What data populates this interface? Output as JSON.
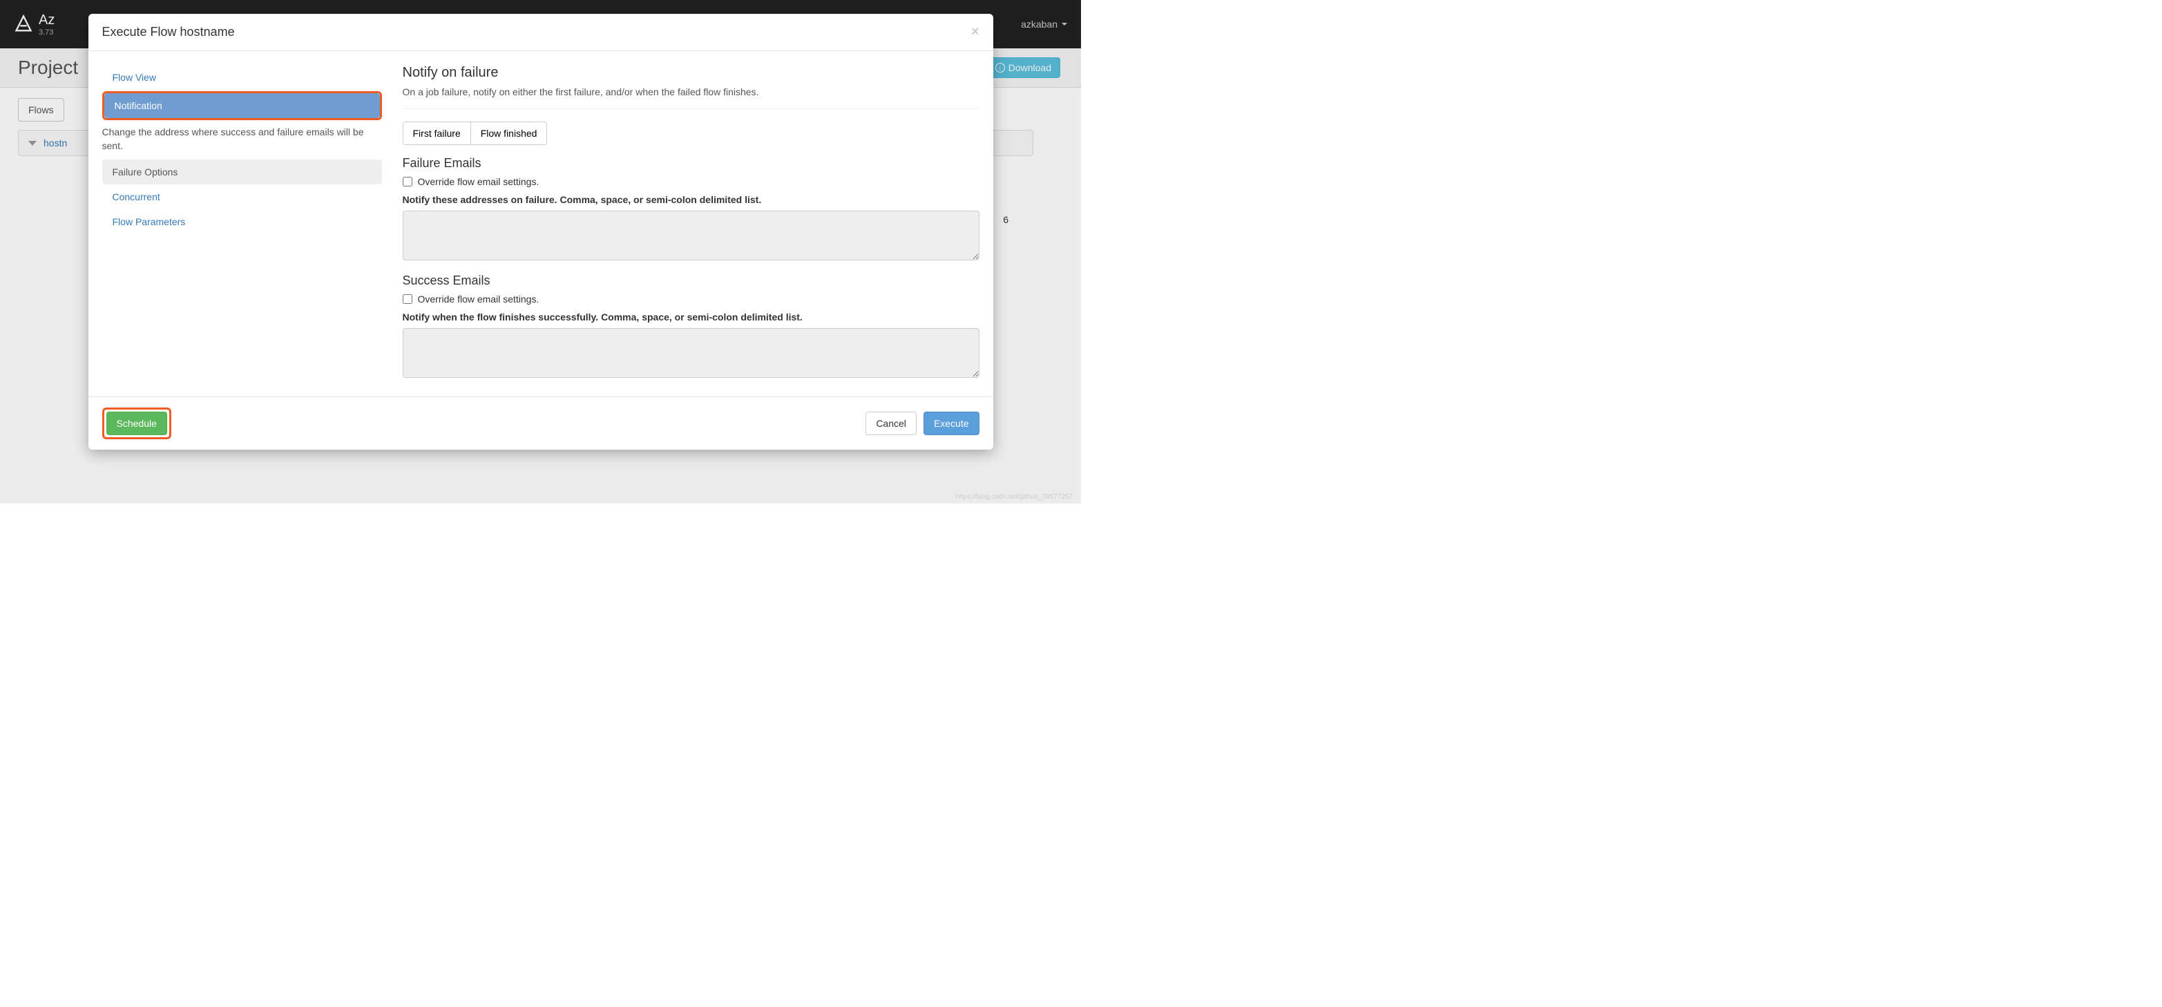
{
  "navbar": {
    "brand": "Az",
    "version": "3.73",
    "user": "azkaban"
  },
  "page": {
    "title": "Project",
    "download_btn": "Download",
    "tab_flows": "Flows",
    "flow_name": "hostn",
    "page_num_fragment": "6"
  },
  "modal": {
    "title": "Execute Flow hostname",
    "close": "×",
    "nav": {
      "flow_view": "Flow View",
      "notification": "Notification",
      "notification_desc": "Change the address where success and failure emails will be sent.",
      "failure_options": "Failure Options",
      "concurrent": "Concurrent",
      "flow_parameters": "Flow Parameters"
    },
    "panel": {
      "notify_title": "Notify on failure",
      "notify_desc": "On a job failure, notify on either the first failure, and/or when the failed flow finishes.",
      "btn_first_failure": "First failure",
      "btn_flow_finished": "Flow finished",
      "failure_emails_title": "Failure Emails",
      "override_label": "Override flow email settings.",
      "failure_field_label": "Notify these addresses on failure. Comma, space, or semi-colon delimited list.",
      "success_emails_title": "Success Emails",
      "success_field_label": "Notify when the flow finishes successfully. Comma, space, or semi-colon delimited list."
    },
    "footer": {
      "schedule": "Schedule",
      "cancel": "Cancel",
      "execute": "Execute"
    }
  },
  "watermark": "https://blog.csdn.net/github_39577257"
}
